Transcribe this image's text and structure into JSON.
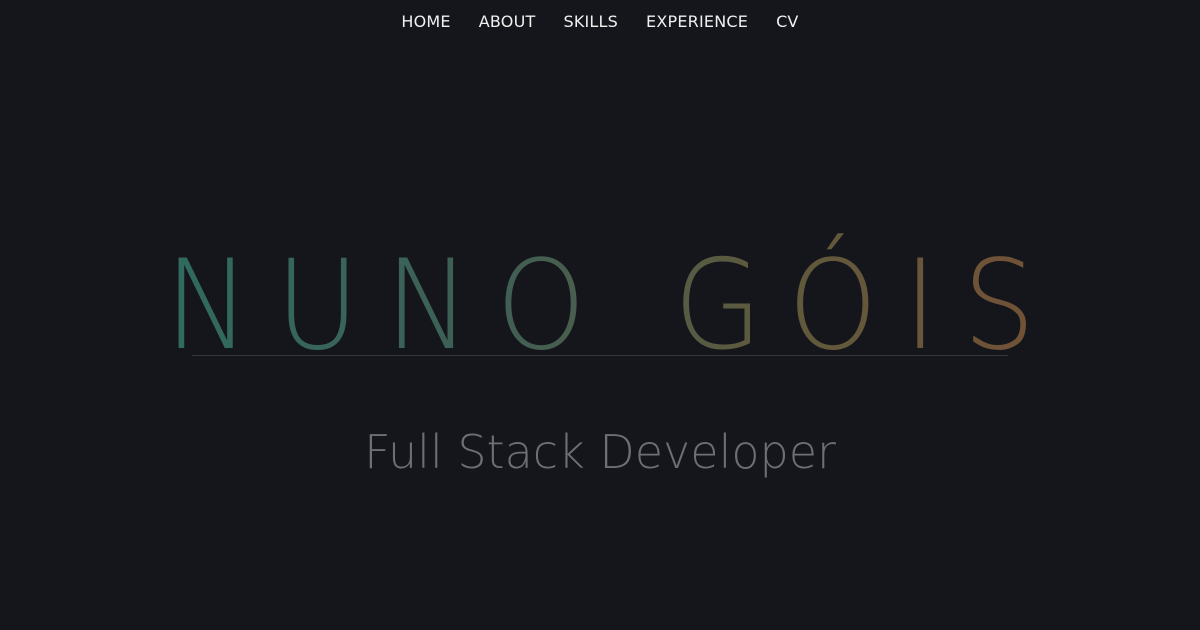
{
  "nav": {
    "items": [
      {
        "label": "HOME"
      },
      {
        "label": "ABOUT"
      },
      {
        "label": "SKILLS"
      },
      {
        "label": "EXPERIENCE"
      },
      {
        "label": "CV"
      }
    ]
  },
  "hero": {
    "name": "NUNO GÓIS",
    "subtitle": "Full Stack Developer"
  },
  "colors": {
    "background": "#15161b",
    "nav_text": "#f0f0f0",
    "name_gradient_start": "#2b6e63",
    "name_gradient_end": "#7a4e34",
    "subtitle": "#6e6f73",
    "divider": "#34363c"
  }
}
